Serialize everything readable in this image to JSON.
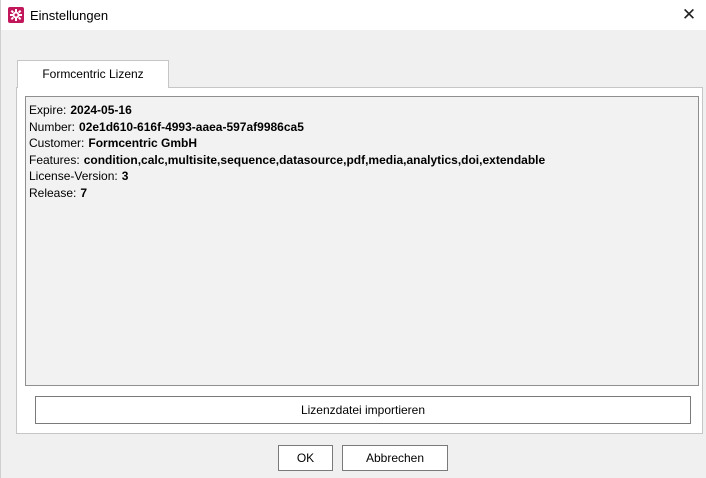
{
  "window": {
    "title": "Einstellungen",
    "close_glyph": "✕",
    "icon": "settings-gear-icon",
    "icon_color": "#c2185b"
  },
  "tabs": [
    {
      "label": "Formcentric Lizenz",
      "selected": true
    }
  ],
  "license": {
    "rows": [
      {
        "label": "Expire:",
        "value": "2024-05-16"
      },
      {
        "label": "Number:",
        "value": "02e1d610-616f-4993-aaea-597af9986ca5"
      },
      {
        "label": "Customer:",
        "value": "Formcentric GmbH"
      },
      {
        "label": "Features:",
        "value": "condition,calc,multisite,sequence,datasource,pdf,media,analytics,doi,extendable"
      },
      {
        "label": "License-Version:",
        "value": "3"
      },
      {
        "label": "Release:",
        "value": "7"
      }
    ]
  },
  "buttons": {
    "import_label": "Lizenzdatei importieren",
    "ok_label": "OK",
    "cancel_label": "Abbrechen"
  }
}
